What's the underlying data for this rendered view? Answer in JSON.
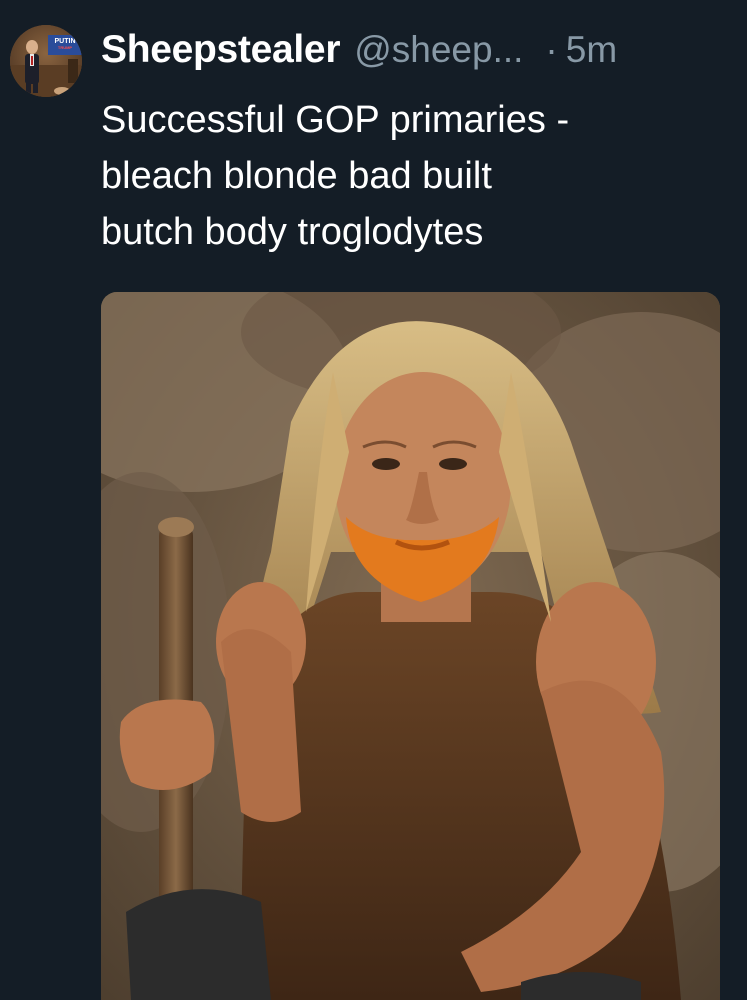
{
  "tweet": {
    "display_name": "Sheepstealer",
    "handle": "@sheep...",
    "separator": "·",
    "time": "5m",
    "text_lines": [
      "Successful GOP primaries -",
      "bleach blonde bad built",
      "butch body troglodytes"
    ],
    "avatar": {
      "sign_text": "PUTIN",
      "sign_subtext": "TRUMP"
    }
  },
  "colors": {
    "background": "#141d26",
    "text_primary": "#ffffff",
    "text_secondary": "#8899a6"
  }
}
